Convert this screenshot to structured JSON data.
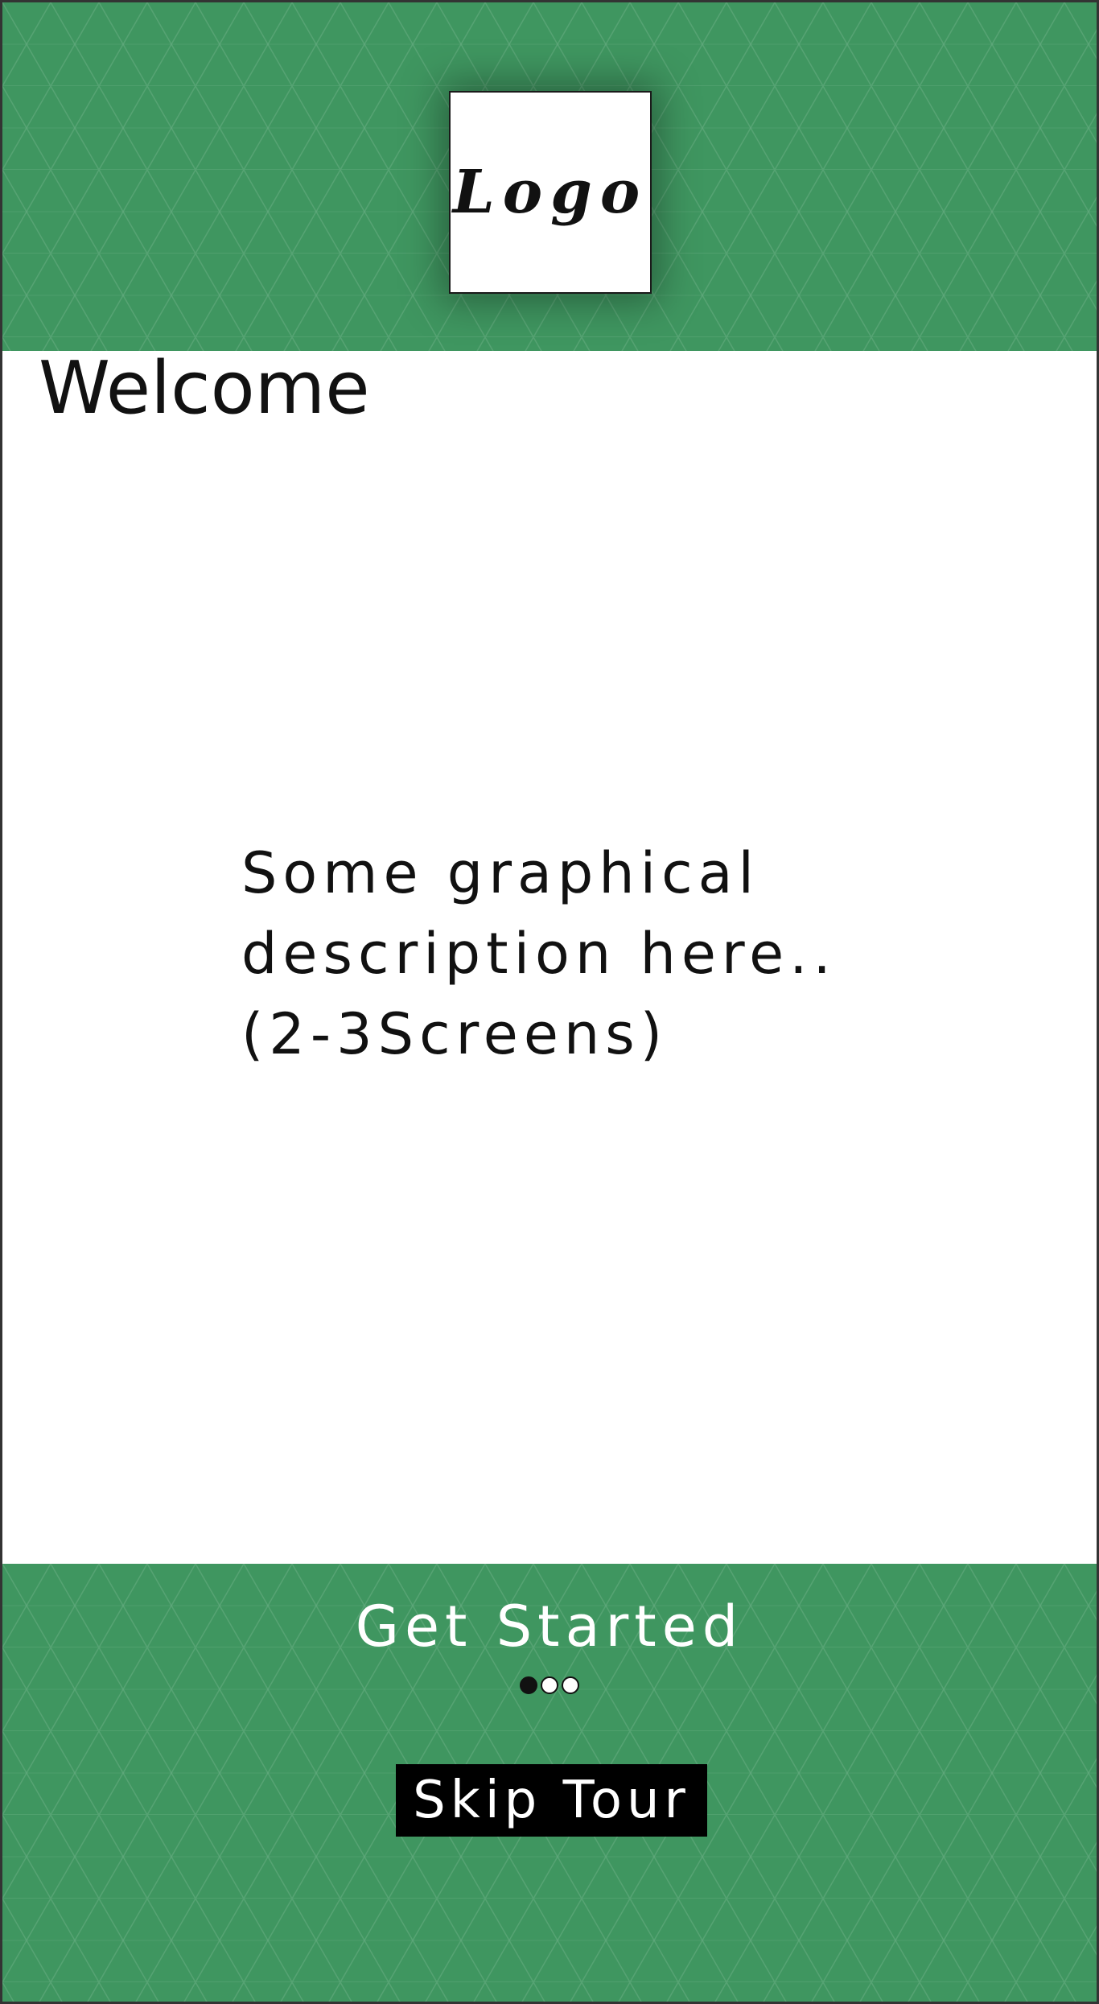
{
  "header": {
    "logo_text": "Logo",
    "background_color": "#3f9660"
  },
  "main": {
    "title": "Welcome",
    "description": "Some graphical\ndescription here..\n(2-3Screens)"
  },
  "footer": {
    "get_started_label": "Get Started",
    "skip_tour_label": "Skip Tour",
    "pager": {
      "total_pages": 3,
      "active_page": 1
    },
    "background_color": "#3f9660"
  }
}
